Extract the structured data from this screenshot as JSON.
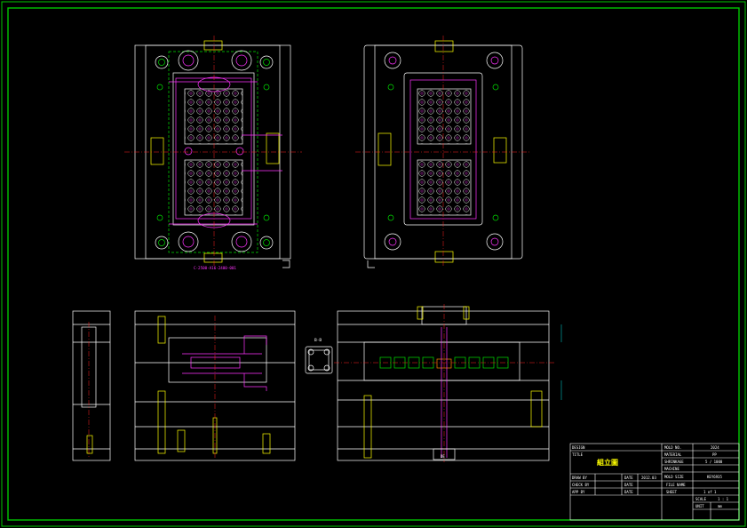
{
  "colors": {
    "background": "#000000",
    "frame": "#00c800",
    "outline": "#ffffff",
    "centerline": "#ff2020",
    "cooling": "#ff33ff",
    "ejector": "#00e000",
    "cavity": "#ff33ff",
    "dimension": "#00e0e0",
    "text": "#ffff00"
  },
  "annotations": {
    "plan_note": "C-2500-A16-2400-001",
    "section_mark": "B-B",
    "sprue_mark": "DE"
  },
  "title_block": {
    "design_label": "DESIGN",
    "title_label": "TITLE",
    "drawing_title": "組立圖",
    "mold_no_label": "MOLD NO.",
    "mold_no_value": "2024",
    "material_label": "MATERIAL",
    "material_value": "PP",
    "shrinkage_label": "SHRINKAGE",
    "shrinkage_value": "5 / 1000",
    "machine_label": "MACHINE",
    "machine_value": "",
    "mold_size_label": "MOLD SIZE",
    "mold_size_value": "KEY6935",
    "drawn_label": "DRAW BY",
    "date_label": "DATE",
    "date_value": "2012.03",
    "checked_label": "CHECK BY",
    "approved_label": "APP BY",
    "file_name_label": "FILE NAME",
    "file_name_value": "",
    "sheet_label": "SHEET",
    "sheet_value": "1 of 1",
    "scale_label": "SCALE",
    "scale_value": "1 : 1",
    "unit_label": "UNIT",
    "unit_value": "mm"
  }
}
